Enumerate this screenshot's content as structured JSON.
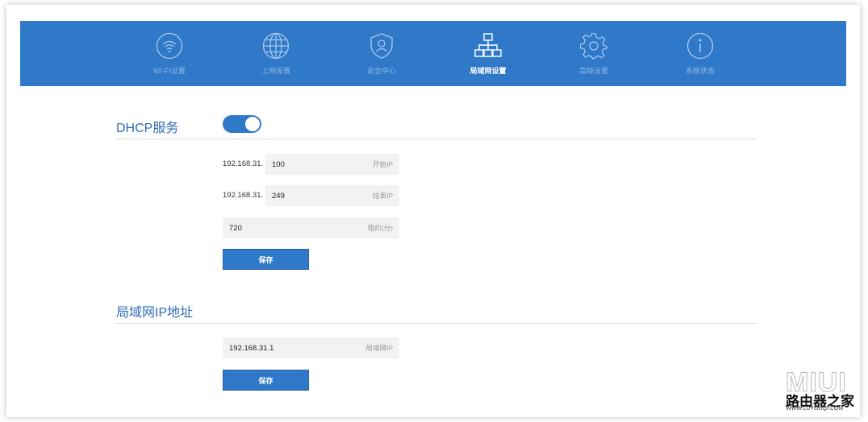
{
  "nav": {
    "items": [
      {
        "label": "WI-FI设置",
        "icon": "wifi-icon"
      },
      {
        "label": "上网设置",
        "icon": "globe-icon"
      },
      {
        "label": "安全中心",
        "icon": "shield-user-icon"
      },
      {
        "label": "局域网设置",
        "icon": "network-icon",
        "active": true
      },
      {
        "label": "高级设置",
        "icon": "gear-icon"
      },
      {
        "label": "系统状态",
        "icon": "info-icon"
      }
    ]
  },
  "dhcp": {
    "title": "DHCP服务",
    "enabled": true,
    "start_prefix": "192.168.31.",
    "start_value": "100",
    "start_hint": "开始IP",
    "end_prefix": "192.168.31.",
    "end_value": "249",
    "end_hint": "结束IP",
    "lease_value": "720",
    "lease_hint": "租约(分)",
    "save_label": "保存"
  },
  "lan": {
    "title": "局域网IP地址",
    "ip_value": "192.168.31.1",
    "ip_hint": "局域网IP",
    "save_label": "保存"
  },
  "watermark": {
    "brand": "MIUI",
    "text": "路由器之家",
    "sub": "WWW.LUYOUQI.COM"
  },
  "colors": {
    "primary": "#3078c8",
    "title": "#2d6db4"
  }
}
